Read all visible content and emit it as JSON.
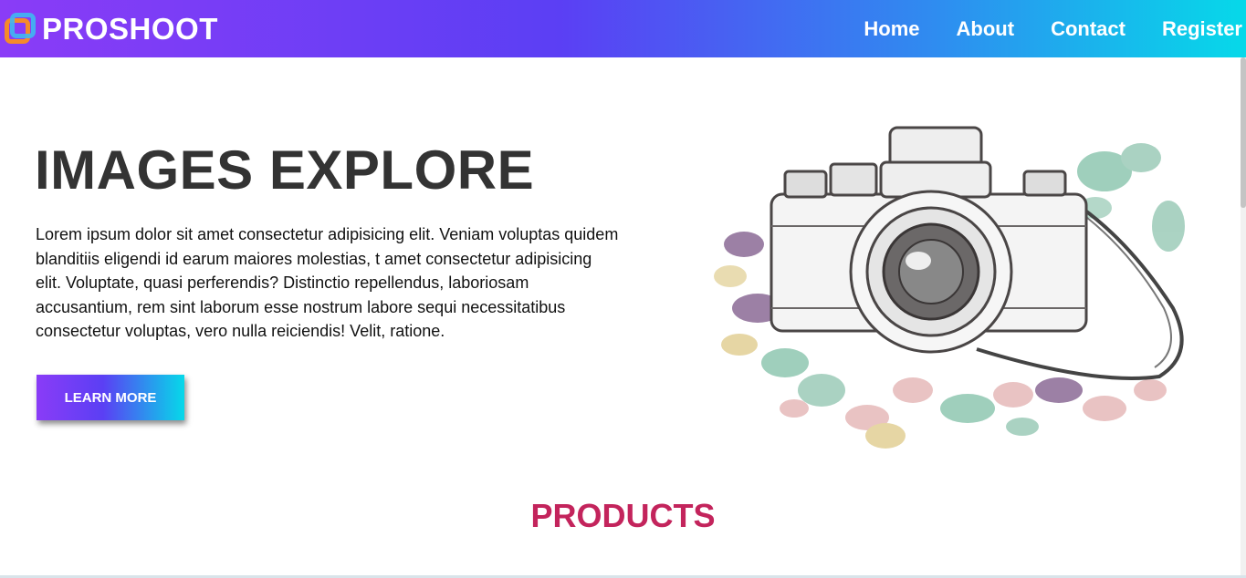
{
  "brand": {
    "name": "PROSHOOT",
    "logo_icon": "layered-squares-logo-icon"
  },
  "nav": {
    "links": [
      "Home",
      "About",
      "Contact",
      "Register"
    ]
  },
  "hero": {
    "title": "IMAGES EXPLORE",
    "text": "Lorem ipsum dolor sit amet consectetur adipisicing elit. Veniam voluptas quidem blanditiis eligendi id earum maiores molestias, t amet consectetur adipisicing elit. Voluptate, quasi perferendis? Distinctio repellendus, laboriosam accusantium, rem sint laborum esse nostrum labore sequi necessitatibus consectetur voluptas, vero nulla reiciendis! Velit, ratione.",
    "button_label": "LEARN MORE",
    "image_icon": "camera-with-flowers-illustration"
  },
  "products": {
    "title": "PRODUCTS"
  },
  "colors": {
    "gradient_start": "#8a3cf7",
    "gradient_mid": "#5b3ff4",
    "gradient_end": "#06d9e9",
    "heading": "#333333",
    "section_title": "#c3245c"
  }
}
